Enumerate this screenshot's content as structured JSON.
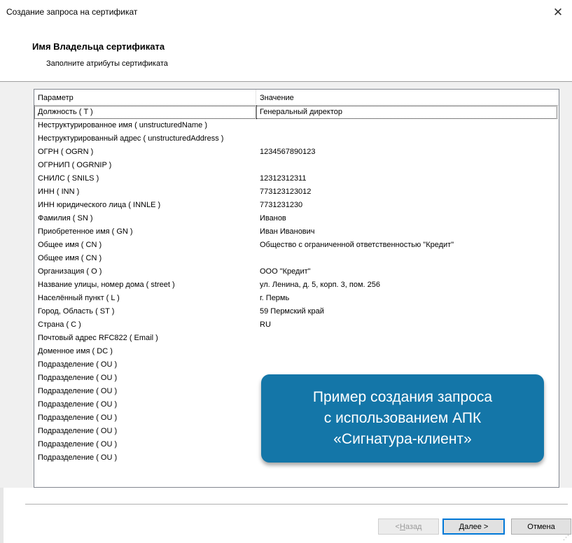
{
  "window": {
    "title": "Создание запроса на сертификат",
    "close_symbol": "✕"
  },
  "header": {
    "title": "Имя Владельца сертификата",
    "subtitle": "Заполните атрибуты сертификата"
  },
  "table": {
    "columns": [
      "Параметр",
      "Значение"
    ],
    "rows": [
      {
        "param": "Должность ( T )",
        "value": "Генеральный директор"
      },
      {
        "param": "Неструктурированное имя ( unstructuredName )",
        "value": ""
      },
      {
        "param": "Неструктурированный адрес ( unstructuredAddress )",
        "value": ""
      },
      {
        "param": "ОГРН ( OGRN )",
        "value": "1234567890123"
      },
      {
        "param": "ОГРНИП ( OGRNIP )",
        "value": ""
      },
      {
        "param": "СНИЛС ( SNILS )",
        "value": "12312312311"
      },
      {
        "param": "ИНН ( INN )",
        "value": "773123123012"
      },
      {
        "param": "ИНН юридического лица ( INNLE )",
        "value": "7731231230"
      },
      {
        "param": "Фамилия ( SN )",
        "value": "Иванов"
      },
      {
        "param": "Приобретенное имя ( GN )",
        "value": "Иван Иванович"
      },
      {
        "param": "Общее имя ( CN )",
        "value": "Общество с ограниченной ответственностью \"Кредит\""
      },
      {
        "param": "Общее имя ( CN )",
        "value": ""
      },
      {
        "param": "Организация ( O )",
        "value": "ООО \"Кредит\""
      },
      {
        "param": "Название улицы, номер дома ( street )",
        "value": "ул. Ленина, д. 5, корп. 3, пом. 256"
      },
      {
        "param": "Населённый пункт ( L )",
        "value": "г. Пермь"
      },
      {
        "param": "Город, Область ( ST )",
        "value": "59 Пермский край"
      },
      {
        "param": "Страна ( C )",
        "value": "RU"
      },
      {
        "param": "Почтовый адрес RFC822 ( Email )",
        "value": ""
      },
      {
        "param": "Доменное имя ( DC )",
        "value": ""
      },
      {
        "param": "Подразделение ( OU )",
        "value": ""
      },
      {
        "param": "Подразделение ( OU )",
        "value": ""
      },
      {
        "param": "Подразделение ( OU )",
        "value": ""
      },
      {
        "param": "Подразделение ( OU )",
        "value": ""
      },
      {
        "param": "Подразделение ( OU )",
        "value": ""
      },
      {
        "param": "Подразделение ( OU )",
        "value": ""
      },
      {
        "param": "Подразделение ( OU )",
        "value": ""
      },
      {
        "param": "Подразделение ( OU )",
        "value": ""
      }
    ]
  },
  "callout": {
    "lines": [
      "Пример создания запроса",
      "с использованием АПК",
      "«Сигнатура-клиент»"
    ],
    "color": "#1476a8"
  },
  "buttons": {
    "back_prefix": "< ",
    "back_underlined": "Н",
    "back_rest": "азад",
    "next_underlined": "Д",
    "next_rest": "алее >",
    "cancel": "Отмена"
  },
  "colors": {
    "focus_border": "#0078d7",
    "dialog_bg": "#f0f0f0"
  }
}
